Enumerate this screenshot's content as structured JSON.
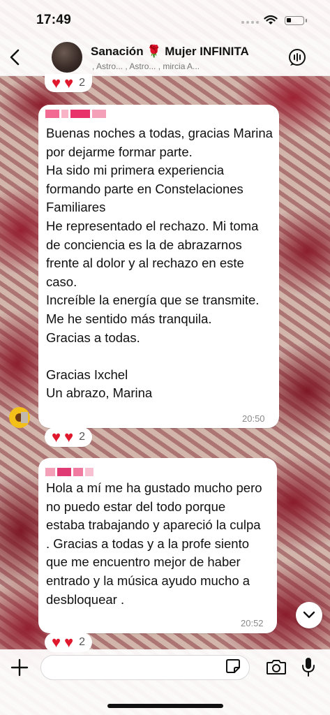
{
  "status_bar": {
    "time": "17:49"
  },
  "header": {
    "title": "Sanación 🌹 Mujer INFINITA",
    "subtitle": ", Astro... , Astro... , mircia A..."
  },
  "messages": [
    {
      "text": "Buenas noches a todas, gracias Marina por dejarme  formar parte.\nHa sido mi primera experiencia formando parte en Constelaciones Familiares\nHe representado el rechazo. Mi toma de conciencia es la de abrazarnos frente al dolor y al rechazo en este caso.\nIncreíble la energía que se transmite. Me he sentido más tranquila.\nGracias a todas.\n\nGracias Ixchel\nUn abrazo, Marina",
      "time": "20:50",
      "reactions": {
        "emojis": "❤️ ❤️",
        "count": "2"
      },
      "sender_color": "#e8326a"
    },
    {
      "text": "Hola a mí me ha gustado mucho pero no puedo estar del todo porque estaba trabajando y apareció la culpa . Gracias a todas y a la profe siento que me encuentro mejor de haber entrado y la música ayudo mucho a desbloquear .",
      "time": "20:52",
      "reactions": {
        "emojis": "❤️ ❤️",
        "count": "2"
      },
      "sender_color": "#d8306e"
    }
  ],
  "top_reactions": {
    "count": "2"
  },
  "input": {
    "placeholder": ""
  },
  "colors": {
    "heart": "#e0182d",
    "bubble": "#ffffff"
  }
}
